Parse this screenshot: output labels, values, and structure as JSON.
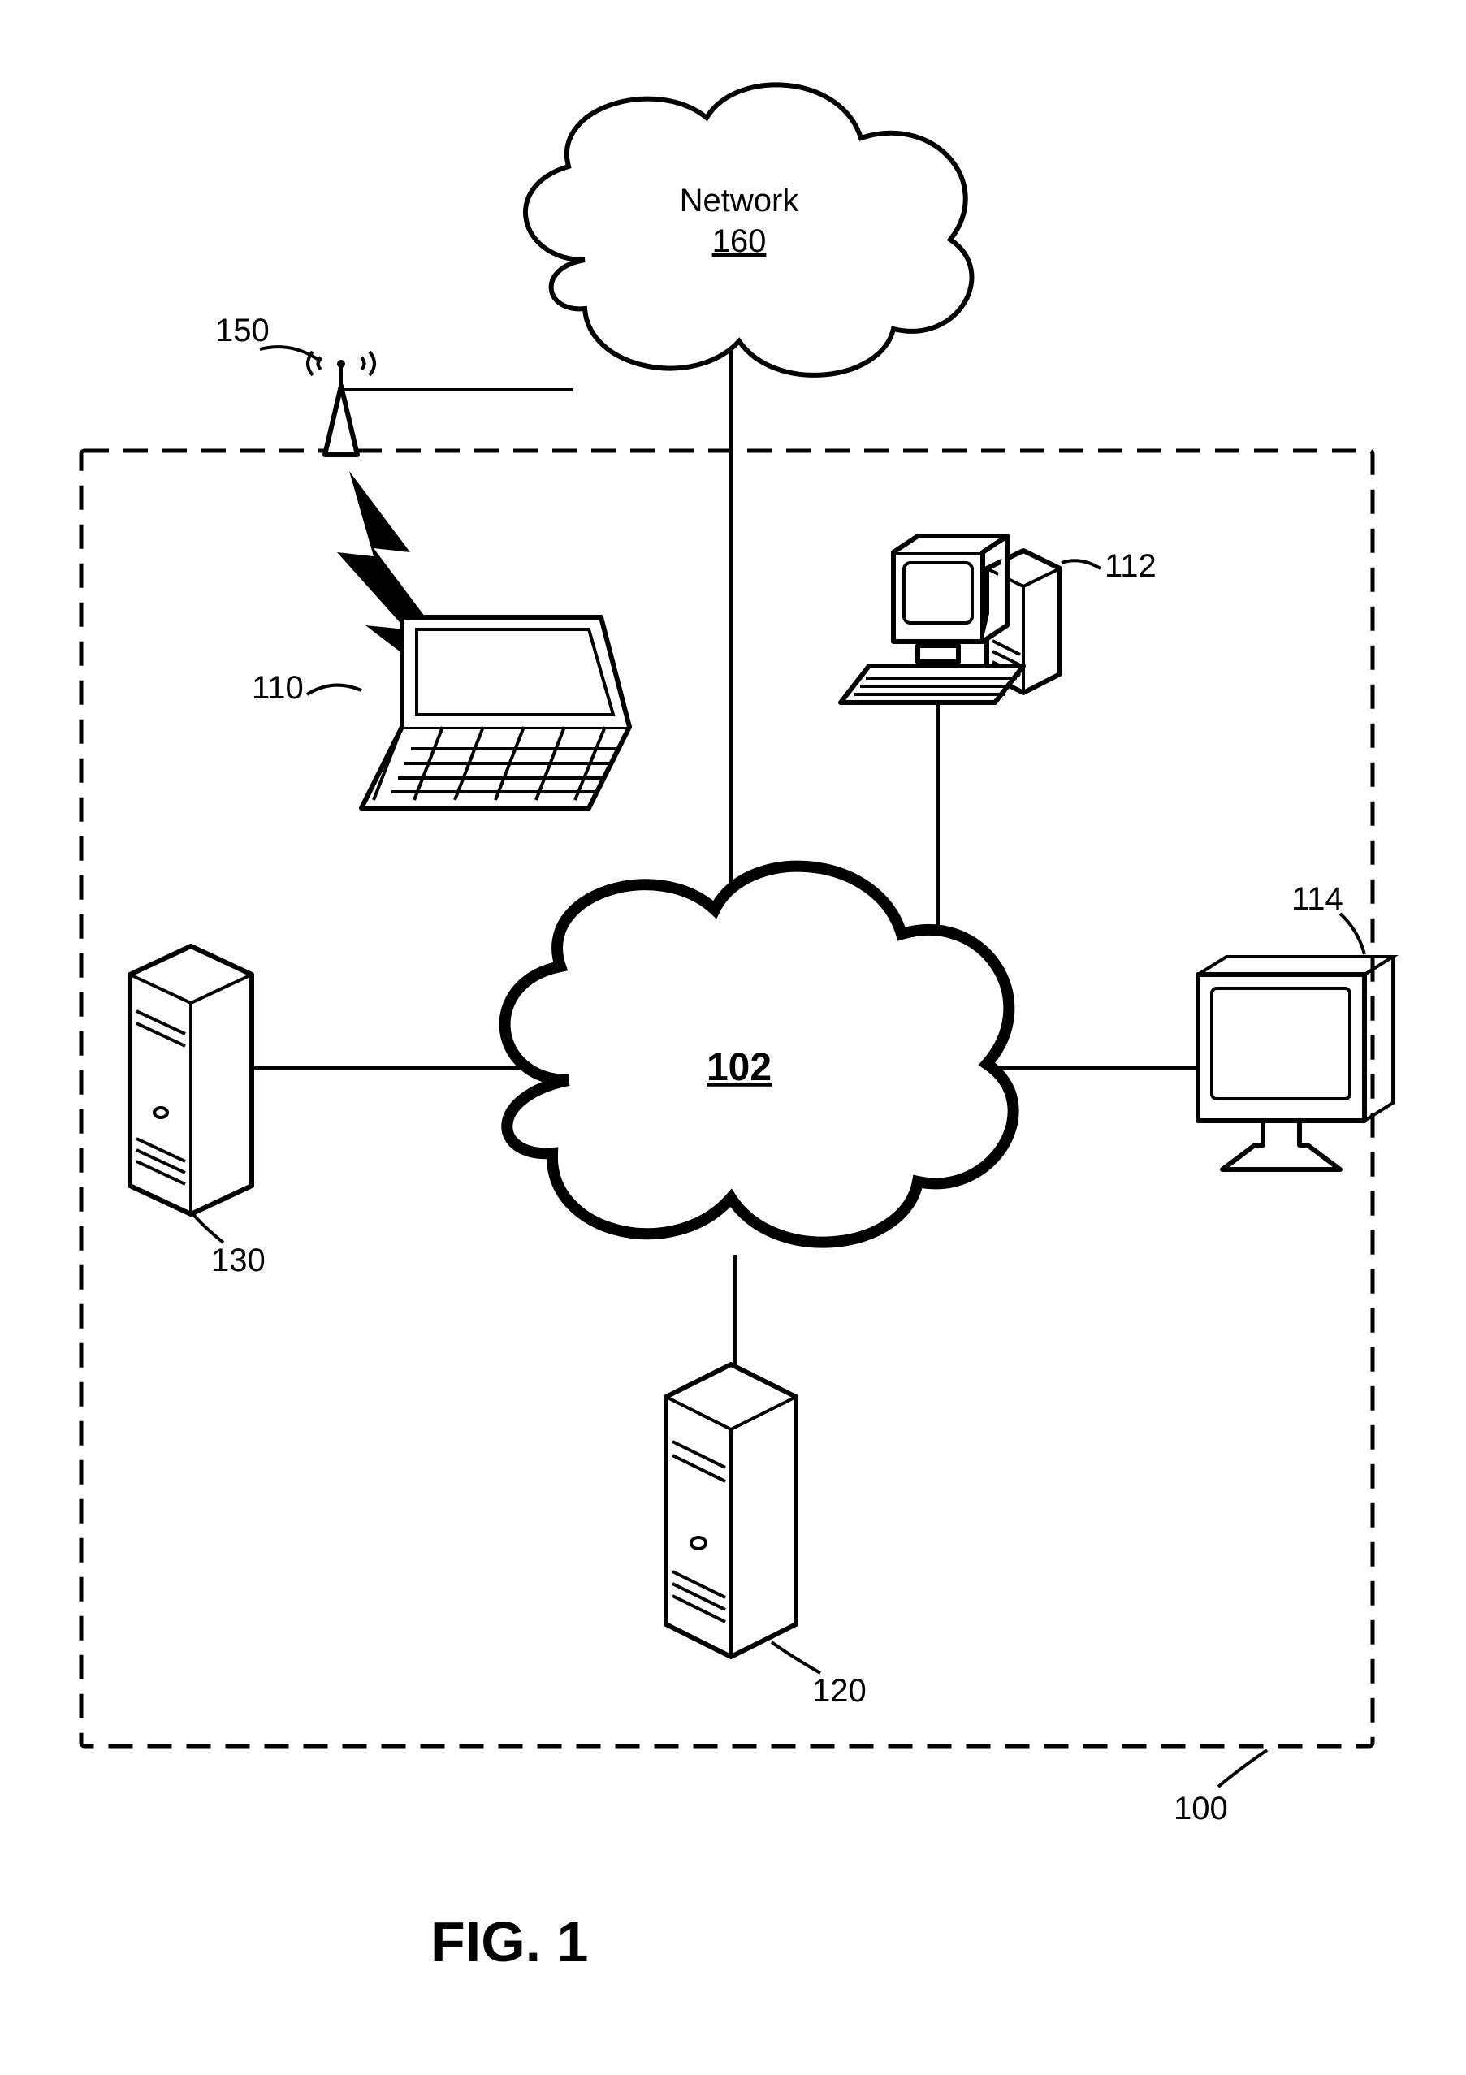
{
  "figure_caption": "FIG. 1",
  "nodes": {
    "external_network": {
      "label_line1": "Network",
      "label_line2": "160",
      "ref": "160"
    },
    "central_cloud": {
      "label": "102",
      "ref": "102"
    },
    "antenna": {
      "ref": "150"
    },
    "laptop": {
      "ref": "110"
    },
    "desktop_pc": {
      "ref": "112"
    },
    "monitor": {
      "ref": "114"
    },
    "server_left": {
      "ref": "130"
    },
    "server_bottom": {
      "ref": "120"
    },
    "system_boundary": {
      "ref": "100"
    }
  }
}
